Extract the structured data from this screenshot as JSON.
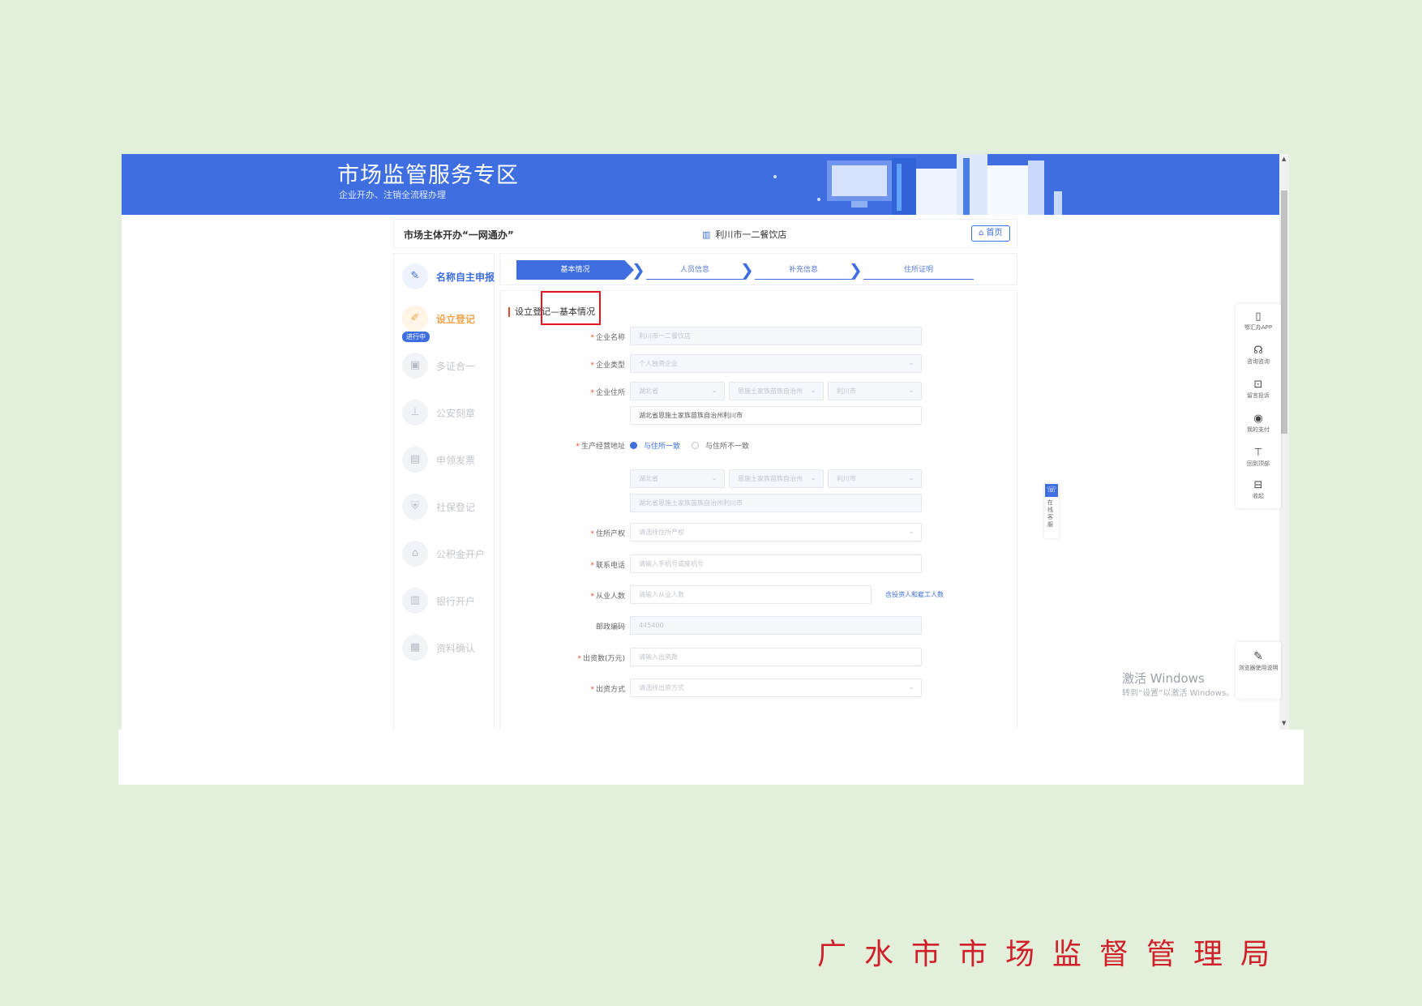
{
  "banner": {
    "title": "市场监管服务专区",
    "subtitle": "企业开办、注销全流程办理"
  },
  "topbar": {
    "title": "市场主体开办“一网通办”",
    "company": "利川市一二餐饮店",
    "home_label": "首页"
  },
  "sidebar": {
    "items": [
      {
        "label": "名称自主申报",
        "icon": "✎",
        "state": "done"
      },
      {
        "label": "设立登记",
        "icon": "✐",
        "state": "active"
      },
      {
        "label": "多证合一",
        "icon": "▣",
        "state": "pending"
      },
      {
        "label": "公安刻章",
        "icon": "⊥",
        "state": "pending"
      },
      {
        "label": "申领发票",
        "icon": "▤",
        "state": "pending"
      },
      {
        "label": "社保登记",
        "icon": "⛨",
        "state": "pending"
      },
      {
        "label": "公积金开户",
        "icon": "⌂",
        "state": "pending"
      },
      {
        "label": "银行开户",
        "icon": "▥",
        "state": "pending"
      },
      {
        "label": "资料确认",
        "icon": "▦",
        "state": "pending"
      }
    ],
    "badge": "进行中"
  },
  "steps": [
    "基本情况",
    "人员信息",
    "补充信息",
    "住所证明"
  ],
  "form": {
    "section_title": "设立登记—基本情况",
    "fields": {
      "company_name": {
        "label": "企业名称",
        "value": "利川市一二餐饮店"
      },
      "company_type": {
        "label": "企业类型",
        "value": "个人独资企业"
      },
      "location": {
        "label": "企业住所",
        "province": "湖北省",
        "prefecture": "恩施土家族苗族自治州",
        "city": "利川市",
        "detail": "湖北省恩施土家族苗族自治州利川市"
      },
      "business_address": {
        "label": "生产经营地址",
        "opt_same": "与住所一致",
        "opt_diff": "与住所不一致",
        "province": "湖北省",
        "prefecture": "恩施土家族苗族自治州",
        "city": "利川市",
        "detail": "湖北省恩施土家族苗族自治州利川市"
      },
      "property_right": {
        "label": "住所产权",
        "placeholder": "请选择住所产权"
      },
      "phone": {
        "label": "联系电话",
        "placeholder": "请输入手机号或座机号"
      },
      "employees": {
        "label": "从业人数",
        "placeholder": "请输入从业人数",
        "link": "含投资人和雇工人数"
      },
      "postcode": {
        "label": "邮政编码",
        "value": "445400"
      },
      "capital": {
        "label": "出资数(万元)",
        "placeholder": "请输入出资数"
      },
      "contribution_method": {
        "label": "出资方式",
        "placeholder": "请选择出资方式"
      }
    }
  },
  "right_toolbar": [
    {
      "label": "鄂汇办APP",
      "icon": "▯"
    },
    {
      "label": "咨询咨询",
      "icon": "☊"
    },
    {
      "label": "留言投诉",
      "icon": "⊡"
    },
    {
      "label": "我的支付",
      "icon": "◉"
    },
    {
      "label": "回到顶部",
      "icon": "⊤"
    },
    {
      "label": "收起",
      "icon": "⊟"
    }
  ],
  "right_toolbar_bottom": {
    "label": "浏览器使用说明",
    "icon": "✎"
  },
  "online_service": {
    "label": "在线客服",
    "icon": "☏"
  },
  "watermark": {
    "line1": "激活 Windows",
    "line2": "转到“设置”以激活 Windows。"
  },
  "footer": {
    "org": "广水市市场监督管理局"
  },
  "colors": {
    "brand": "#3e6ee0",
    "active": "#f0a34a",
    "accent_red": "#d0202a",
    "page_bg": "#e2efdb"
  }
}
